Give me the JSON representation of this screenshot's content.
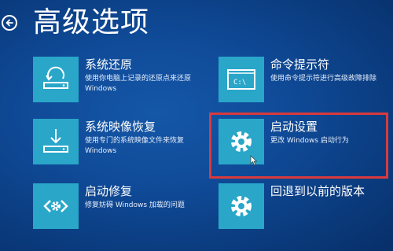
{
  "header": {
    "title": "高级选项",
    "back_icon": "back-arrow-icon"
  },
  "tiles": [
    {
      "id": "system-restore",
      "title": "系统还原",
      "desc": "使用你电脑上记录的还原点来还原 Windows",
      "icon": "restore-icon"
    },
    {
      "id": "command-prompt",
      "title": "命令提示符",
      "desc": "使用命令提示符进行高级故障排除",
      "icon": "command-prompt-icon",
      "icon_text": "C:\\"
    },
    {
      "id": "system-image-recovery",
      "title": "系统映像恢复",
      "desc": "使用专门的系统映像文件来恢复 Windows",
      "icon": "image-recovery-icon"
    },
    {
      "id": "startup-settings",
      "title": "启动设置",
      "desc": "更改 Windows 启动行为",
      "icon": "gear-icon",
      "highlighted": true
    },
    {
      "id": "startup-repair",
      "title": "启动修复",
      "desc": "修复妨碍 Windows 加载的问题",
      "icon": "repair-icon"
    },
    {
      "id": "go-back-previous",
      "title": "回退到以前的版本",
      "desc": "",
      "icon": "gear-icon"
    }
  ],
  "colors": {
    "background": "#0b3e83",
    "tile_accent": "#2aa6c9",
    "highlight": "#d83a3e"
  }
}
